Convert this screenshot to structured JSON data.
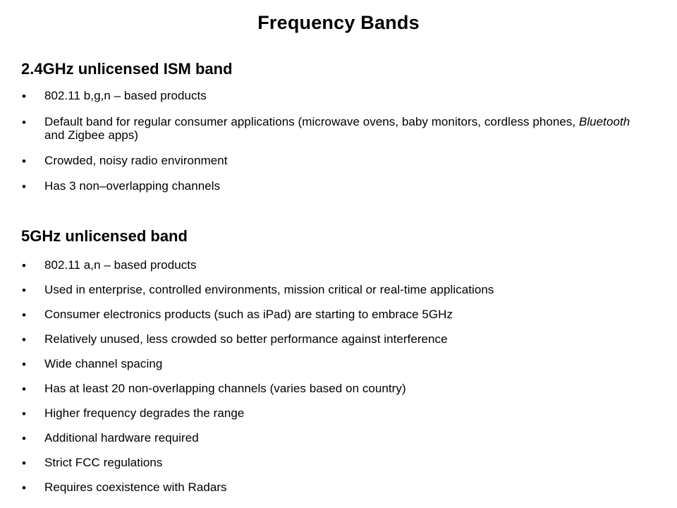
{
  "slide": {
    "title": "Frequency Bands",
    "background_color": "#ffffff",
    "text_color": "#000000",
    "bullet_glyph": "•"
  },
  "sections": [
    {
      "heading": "2.4GHz unlicensed ISM band",
      "bullets": [
        {
          "text": "802.11 b,g,n – based products"
        },
        {
          "line1_a": "Default band for regular consumer applications (microwave ovens, baby monitors, cordless phones, ",
          "italic": "Bluetooth",
          "line1_b": " and Zigbee apps)"
        },
        {
          "text": "Crowded, noisy radio environment"
        },
        {
          "text": "Has 3 non–overlapping channels"
        }
      ]
    },
    {
      "heading": "5GHz unlicensed band",
      "bullets": [
        {
          "text": "802.11 a,n – based products"
        },
        {
          "text": "Used in enterprise, controlled environments, mission critical or real-time applications"
        },
        {
          "text": "Consumer electronics products (such as iPad) are starting to embrace 5GHz"
        },
        {
          "text": "Relatively unused, less crowded so better performance against interference"
        },
        {
          "text": "Wide channel spacing"
        },
        {
          "text": "Has at least 20 non-overlapping channels (varies based on country)"
        },
        {
          "text": "Higher frequency degrades the range"
        },
        {
          "text": "Additional hardware required"
        },
        {
          "text": "Strict FCC regulations"
        },
        {
          "text": "Requires coexistence with Radars"
        }
      ]
    }
  ]
}
